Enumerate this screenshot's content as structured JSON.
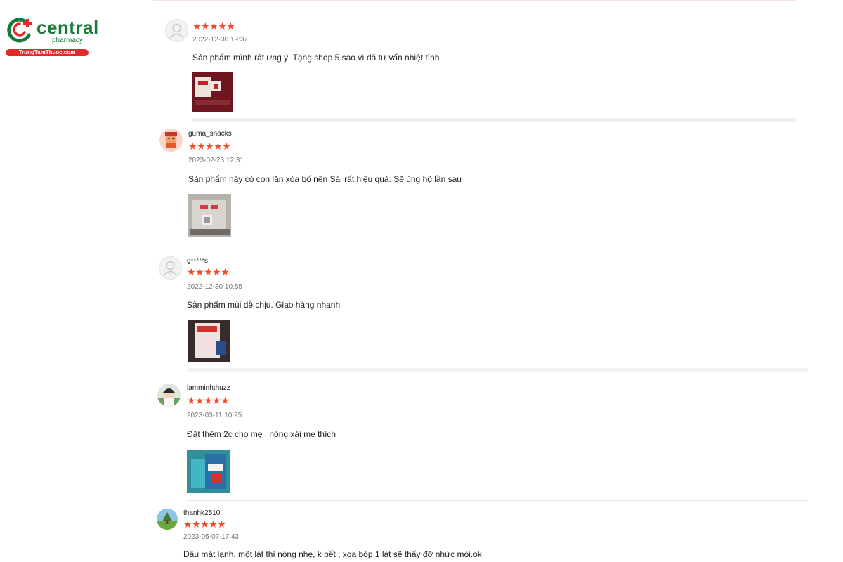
{
  "brand": {
    "name": "central",
    "subtitle": "pharmacy",
    "url_label": "TrungTamThuoc.com"
  },
  "colors": {
    "star": "#ee4d2d",
    "brand_green": "#1a7a3a",
    "brand_red": "#e22a2a"
  },
  "reviews": [
    {
      "username": "",
      "stars": "★★★★★",
      "rating": 5,
      "date": "2022-12-30 19:37",
      "text": "Sản phẩm mình rất ưng ý. Tặng shop 5 sao vì đã tư vấn nhiệt tình",
      "avatar": "default-user-icon"
    },
    {
      "username": "guma_snacks",
      "stars": "★★★★★",
      "rating": 5,
      "date": "2023-02-23 12:31",
      "text": "Sản phẩm này có con lăn xóa bố nên Sài rất hiệu quả. Sẽ ủng hộ lần sau",
      "avatar": "photo"
    },
    {
      "username": "g*****s",
      "stars": "★★★★★",
      "rating": 5,
      "date": "2022-12-30 10:55",
      "text": "Sản phẩm mùi dễ chịu. Giao hàng nhanh",
      "avatar": "default-user-icon"
    },
    {
      "username": "lamminhthuzz",
      "stars": "★★★★★",
      "rating": 5,
      "date": "2023-03-11 10:25",
      "text": "Đặt thêm 2c cho mẹ , nóng xài mẹ thích",
      "avatar": "photo"
    },
    {
      "username": "thanhk2510",
      "stars": "★★★★★",
      "rating": 5,
      "date": "2023-05-07 17:43",
      "text": "Dầu mát lạnh, một lát thì nóng nhẹ, k bết , xoa bóp 1 lát sẽ thấy đỡ nhức mỏi.ok",
      "avatar": "photo"
    }
  ]
}
